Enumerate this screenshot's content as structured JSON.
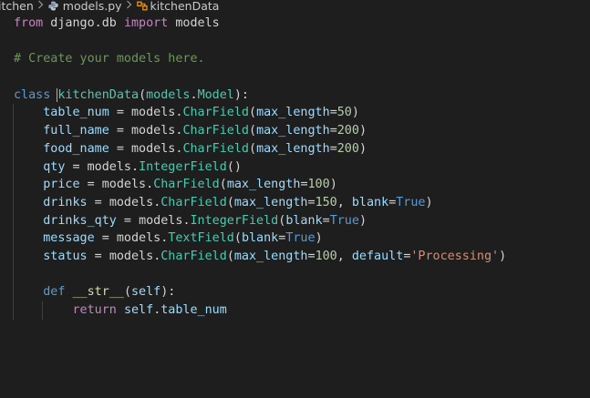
{
  "breadcrumb": {
    "folder": "itchen",
    "file": "models.py",
    "symbol": "kitchenData"
  },
  "icons": {
    "separator": "chevron-right-icon",
    "file_icon": "python-file-icon",
    "symbol_icon": "class-symbol-icon"
  },
  "colors": {
    "background": "#1e1e1e",
    "keyword": "#c586c0",
    "keyword_blue": "#569cd6",
    "class": "#4ec9b0",
    "function": "#dcdcaa",
    "variable": "#9cdcfe",
    "number": "#b5cea8",
    "string": "#ce9178",
    "comment": "#6a9955"
  },
  "code": {
    "l1": {
      "kw_from": "from",
      "module": " django.db ",
      "kw_import": "import",
      "name": " models"
    },
    "l3": {
      "comment": "# Create your models here."
    },
    "l5": {
      "kw_class": "class",
      "space": " ",
      "k": "k",
      "name": "itchenData",
      "p1": "(",
      "base_mod": "models",
      "dot": ".",
      "base_cls": "Model",
      "p2": "):"
    },
    "fields": [
      {
        "name": "table_num",
        "eq": " = ",
        "mod": "models",
        "dot": ".",
        "type": "CharField",
        "open": "(",
        "arg1": "max_length",
        "eq1": "=",
        "val1": "50",
        "close": ")"
      },
      {
        "name": "full_name",
        "eq": " = ",
        "mod": "models",
        "dot": ".",
        "type": "CharField",
        "open": "(",
        "arg1": "max_length",
        "eq1": "=",
        "val1": "200",
        "close": ")"
      },
      {
        "name": "food_name",
        "eq": " = ",
        "mod": "models",
        "dot": ".",
        "type": "CharField",
        "open": "(",
        "arg1": "max_length",
        "eq1": "=",
        "val1": "200",
        "close": ")"
      },
      {
        "name": "qty",
        "eq": " = ",
        "mod": "models",
        "dot": ".",
        "type": "IntegerField",
        "open": "(",
        "close": ")"
      },
      {
        "name": "price",
        "eq": " = ",
        "mod": "models",
        "dot": ".",
        "type": "CharField",
        "open": "(",
        "arg1": "max_length",
        "eq1": "=",
        "val1": "100",
        "close": ")"
      },
      {
        "name": "drinks",
        "eq": " = ",
        "mod": "models",
        "dot": ".",
        "type": "CharField",
        "open": "(",
        "arg1": "max_length",
        "eq1": "=",
        "val1": "150",
        "comma": ", ",
        "arg2": "blank",
        "eq2": "=",
        "val2": "True",
        "close": ")"
      },
      {
        "name": "drinks_qty",
        "eq": " = ",
        "mod": "models",
        "dot": ".",
        "type": "IntegerField",
        "open": "(",
        "arg1": "blank",
        "eq1": "=",
        "val1": "True",
        "close": ")"
      },
      {
        "name": "message",
        "eq": " = ",
        "mod": "models",
        "dot": ".",
        "type": "TextField",
        "open": "(",
        "arg1": "blank",
        "eq1": "=",
        "val1": "True",
        "close": ")"
      },
      {
        "name": "status",
        "eq": " = ",
        "mod": "models",
        "dot": ".",
        "type": "CharField",
        "open": "(",
        "arg1": "max_length",
        "eq1": "=",
        "val1": "100",
        "comma": ", ",
        "arg2": "default",
        "eq2": "=",
        "val2": "'Processing'",
        "close": ")"
      }
    ],
    "l17": {
      "kw_def": "def",
      "space": " ",
      "name": "__str__",
      "p1": "(",
      "self": "self",
      "p2": "):"
    },
    "l18": {
      "kw_return": "return",
      "space": " ",
      "self": "self",
      "dot": ".",
      "attr": "table_num"
    }
  }
}
